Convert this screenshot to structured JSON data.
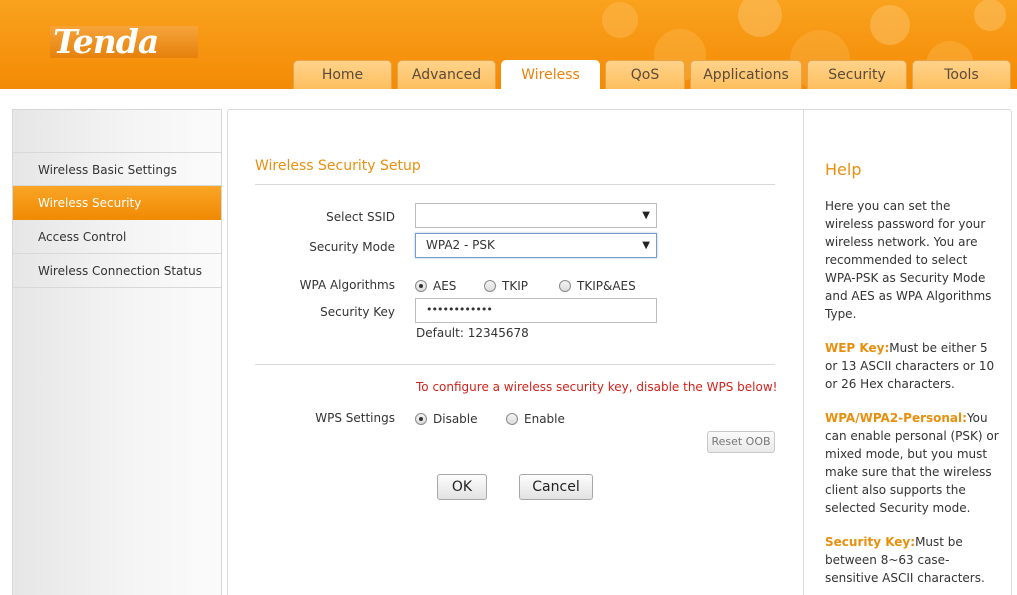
{
  "header": {
    "logo_text": "Tenda",
    "tabs": [
      {
        "label": "Home"
      },
      {
        "label": "Advanced"
      },
      {
        "label": "Wireless",
        "active": true
      },
      {
        "label": "QoS"
      },
      {
        "label": "Applications"
      },
      {
        "label": "Security"
      },
      {
        "label": "Tools"
      }
    ]
  },
  "sidebar": {
    "items": [
      {
        "label": "Wireless Basic Settings"
      },
      {
        "label": "Wireless Security",
        "active": true
      },
      {
        "label": "Access Control"
      },
      {
        "label": "Wireless Connection Status"
      }
    ]
  },
  "form": {
    "title": "Wireless Security Setup",
    "ssid_label": "Select SSID",
    "ssid_value": "",
    "mode_label": "Security Mode",
    "mode_value": "WPA2 - PSK",
    "algo_label": "WPA Algorithms",
    "algo_options": [
      "AES",
      "TKIP",
      "TKIP&AES"
    ],
    "algo_selected": "AES",
    "key_label": "Security Key",
    "key_value": "••••••••••••",
    "key_default": "Default: 12345678",
    "wps_warning": "To configure a wireless security key, disable the WPS below!",
    "wps_label": "WPS Settings",
    "wps_options": [
      "Disable",
      "Enable"
    ],
    "wps_selected": "Disable",
    "reset_oob": "Reset OOB",
    "ok": "OK",
    "cancel": "Cancel"
  },
  "help": {
    "title": "Help",
    "intro": "Here you can set the wireless password for your wireless network. You are recommended to select WPA-PSK as Security Mode and AES as WPA Algorithms Type.",
    "wep_key_term": "WEP Key:",
    "wep_key_text": "Must be either 5 or 13 ASCII characters or 10 or 26 Hex characters.",
    "wpa_term": "WPA/WPA2-Personal:",
    "wpa_text": "You can enable personal (PSK) or mixed mode, but you must make sure that the wireless client also supports the selected Security mode.",
    "seckey_term": "Security Key:",
    "seckey_text": "Must be between 8~63 case-sensitive ASCII characters."
  },
  "colors": {
    "brand_orange": "#f48a05",
    "accent_text": "#e8900e",
    "warning_red": "#d0231b"
  }
}
